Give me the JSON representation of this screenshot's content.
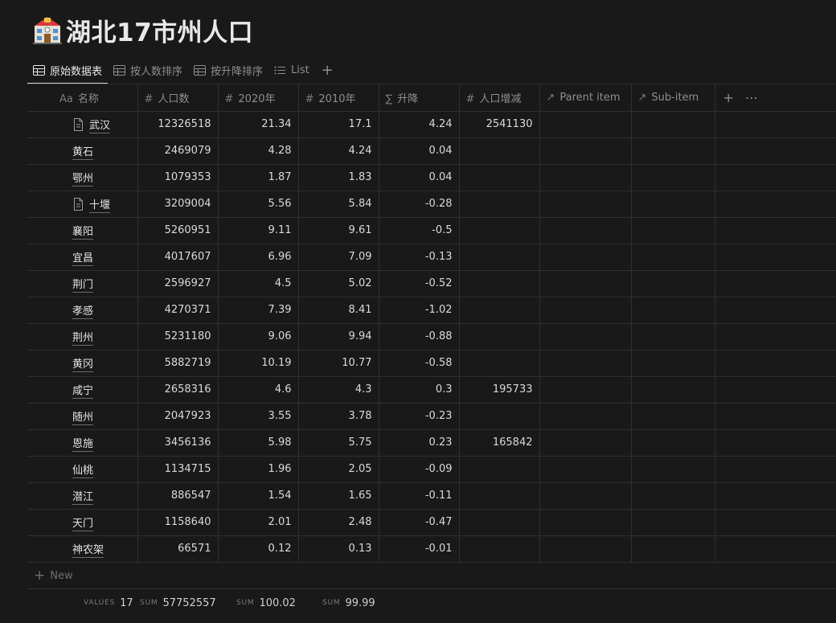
{
  "page": {
    "icon": "school-building-icon",
    "title": "湖北17市州人口"
  },
  "tabs": [
    {
      "label": "原始数据表",
      "icon": "table-icon",
      "active": true
    },
    {
      "label": "按人数排序",
      "icon": "table-icon",
      "active": false
    },
    {
      "label": "按升降排序",
      "icon": "table-icon",
      "active": false
    },
    {
      "label": "List",
      "icon": "list-icon",
      "active": false
    }
  ],
  "columns": [
    {
      "label": "名称",
      "icon": "Aa",
      "type": "title"
    },
    {
      "label": "人口数",
      "icon": "#",
      "type": "number"
    },
    {
      "label": "2020年",
      "icon": "#",
      "type": "number"
    },
    {
      "label": "2010年",
      "icon": "#",
      "type": "number"
    },
    {
      "label": "升降",
      "icon": "∑",
      "type": "formula"
    },
    {
      "label": "人口增减",
      "icon": "#",
      "type": "number"
    },
    {
      "label": "Parent item",
      "icon": "↗",
      "type": "relation"
    },
    {
      "label": "Sub-item",
      "icon": "↗",
      "type": "relation"
    }
  ],
  "rows": [
    {
      "name": "武汉",
      "doc": true,
      "pop": "12326518",
      "y2020": "21.34",
      "y2010": "17.1",
      "change": "4.24",
      "delta": "2541130"
    },
    {
      "name": "黄石",
      "doc": false,
      "pop": "2469079",
      "y2020": "4.28",
      "y2010": "4.24",
      "change": "0.04",
      "delta": ""
    },
    {
      "name": "鄂州",
      "doc": false,
      "pop": "1079353",
      "y2020": "1.87",
      "y2010": "1.83",
      "change": "0.04",
      "delta": ""
    },
    {
      "name": "十堰",
      "doc": true,
      "pop": "3209004",
      "y2020": "5.56",
      "y2010": "5.84",
      "change": "-0.28",
      "delta": ""
    },
    {
      "name": "襄阳",
      "doc": false,
      "pop": "5260951",
      "y2020": "9.11",
      "y2010": "9.61",
      "change": "-0.5",
      "delta": ""
    },
    {
      "name": "宜昌",
      "doc": false,
      "pop": "4017607",
      "y2020": "6.96",
      "y2010": "7.09",
      "change": "-0.13",
      "delta": ""
    },
    {
      "name": "荆门",
      "doc": false,
      "pop": "2596927",
      "y2020": "4.5",
      "y2010": "5.02",
      "change": "-0.52",
      "delta": ""
    },
    {
      "name": "孝感",
      "doc": false,
      "pop": "4270371",
      "y2020": "7.39",
      "y2010": "8.41",
      "change": "-1.02",
      "delta": ""
    },
    {
      "name": "荆州",
      "doc": false,
      "pop": "5231180",
      "y2020": "9.06",
      "y2010": "9.94",
      "change": "-0.88",
      "delta": ""
    },
    {
      "name": "黄冈",
      "doc": false,
      "pop": "5882719",
      "y2020": "10.19",
      "y2010": "10.77",
      "change": "-0.58",
      "delta": ""
    },
    {
      "name": "咸宁",
      "doc": false,
      "pop": "2658316",
      "y2020": "4.6",
      "y2010": "4.3",
      "change": "0.3",
      "delta": "195733"
    },
    {
      "name": "随州",
      "doc": false,
      "pop": "2047923",
      "y2020": "3.55",
      "y2010": "3.78",
      "change": "-0.23",
      "delta": ""
    },
    {
      "name": "恩施",
      "doc": false,
      "pop": "3456136",
      "y2020": "5.98",
      "y2010": "5.75",
      "change": "0.23",
      "delta": "165842"
    },
    {
      "name": "仙桃",
      "doc": false,
      "pop": "1134715",
      "y2020": "1.96",
      "y2010": "2.05",
      "change": "-0.09",
      "delta": ""
    },
    {
      "name": "潜江",
      "doc": false,
      "pop": "886547",
      "y2020": "1.54",
      "y2010": "1.65",
      "change": "-0.11",
      "delta": ""
    },
    {
      "name": "天门",
      "doc": false,
      "pop": "1158640",
      "y2020": "2.01",
      "y2010": "2.48",
      "change": "-0.47",
      "delta": ""
    },
    {
      "name": "神农架",
      "doc": false,
      "pop": "66571",
      "y2020": "0.12",
      "y2010": "0.13",
      "change": "-0.01",
      "delta": ""
    }
  ],
  "new_label": "New",
  "footer": {
    "count_label": "VALUES",
    "count_value": "17",
    "pop_label": "SUM",
    "pop_value": "57752557",
    "y2020_label": "SUM",
    "y2020_value": "100.02",
    "y2010_label": "SUM",
    "y2010_value": "99.99"
  },
  "colors": {
    "background": "#191919",
    "text": "#d4d4d4",
    "muted": "#8d8d8d",
    "grid_line": "#2f2f2f"
  }
}
